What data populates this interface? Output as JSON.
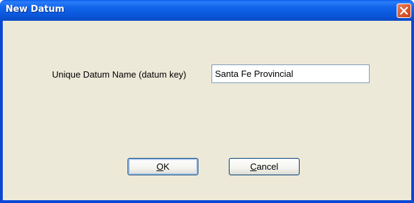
{
  "window": {
    "title": "New Datum",
    "close_icon": "close-icon"
  },
  "form": {
    "datum_name_label": "Unique Datum Name (datum key)",
    "datum_name_value": "Santa Fe Provincial"
  },
  "buttons": {
    "ok": {
      "accel": "O",
      "rest": "K"
    },
    "cancel": {
      "accel": "C",
      "rest": "ancel"
    }
  },
  "colors": {
    "titlebar": "#0a58dc",
    "dialog_background": "#ece9d8",
    "close_button": "#e05f36",
    "button_border": "#003c74"
  }
}
